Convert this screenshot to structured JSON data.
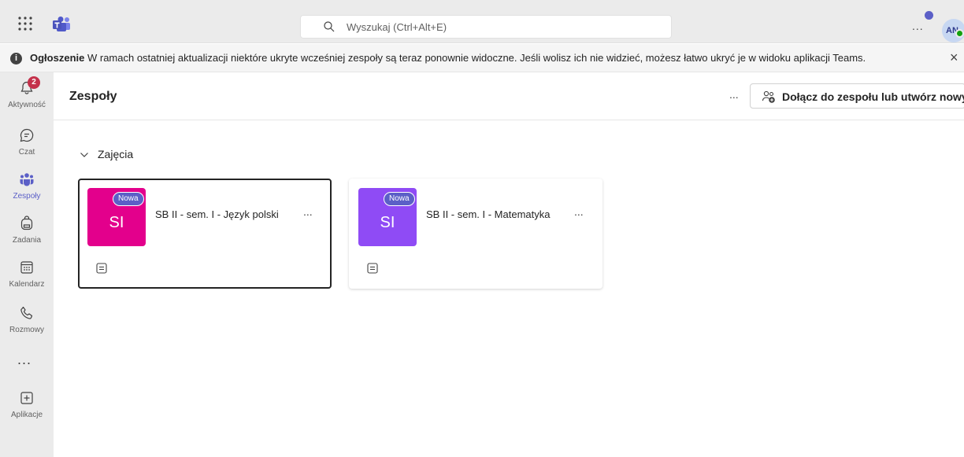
{
  "topbar": {
    "search_placeholder": "Wyszukaj (Ctrl+Alt+E)",
    "more": "...",
    "avatar_initials": "AN"
  },
  "banner": {
    "title": "Ogłoszenie",
    "message": "W ramach ostatniej aktualizacji niektóre ukryte wcześniej zespoły są teraz ponownie widoczne. Jeśli wolisz ich nie widzieć, możesz łatwo ukryć je w widoku aplikacji Teams.",
    "close": "×"
  },
  "rail": {
    "items": [
      {
        "label": "Aktywność",
        "icon": "bell-icon",
        "badge": "2"
      },
      {
        "label": "Czat",
        "icon": "chat-icon"
      },
      {
        "label": "Zespoły",
        "icon": "teams-icon",
        "active": true
      },
      {
        "label": "Zadania",
        "icon": "backpack-icon"
      },
      {
        "label": "Kalendarz",
        "icon": "calendar-icon"
      },
      {
        "label": "Rozmowy",
        "icon": "phone-icon"
      },
      {
        "label": "Aplikacje",
        "icon": "add-apps-icon"
      }
    ],
    "more": "..."
  },
  "main": {
    "title": "Zespoły",
    "more": "...",
    "join_button": "Dołącz do zespołu lub utwórz nowy",
    "group": {
      "label": "Zajęcia",
      "teams": [
        {
          "name": "SB II - sem. I - Język polski",
          "initials": "SI",
          "badge": "Nowa",
          "color": "#e3008c",
          "more": "...",
          "selected": true
        },
        {
          "name": "SB II - sem. I - Matematyka",
          "initials": "SI",
          "badge": "Nowa",
          "color": "#8f4bf5",
          "more": "..."
        }
      ]
    }
  },
  "colors": {
    "accent": "#5b5fc7",
    "badge": "#c4314b",
    "rail_bg": "#ebebeb"
  }
}
